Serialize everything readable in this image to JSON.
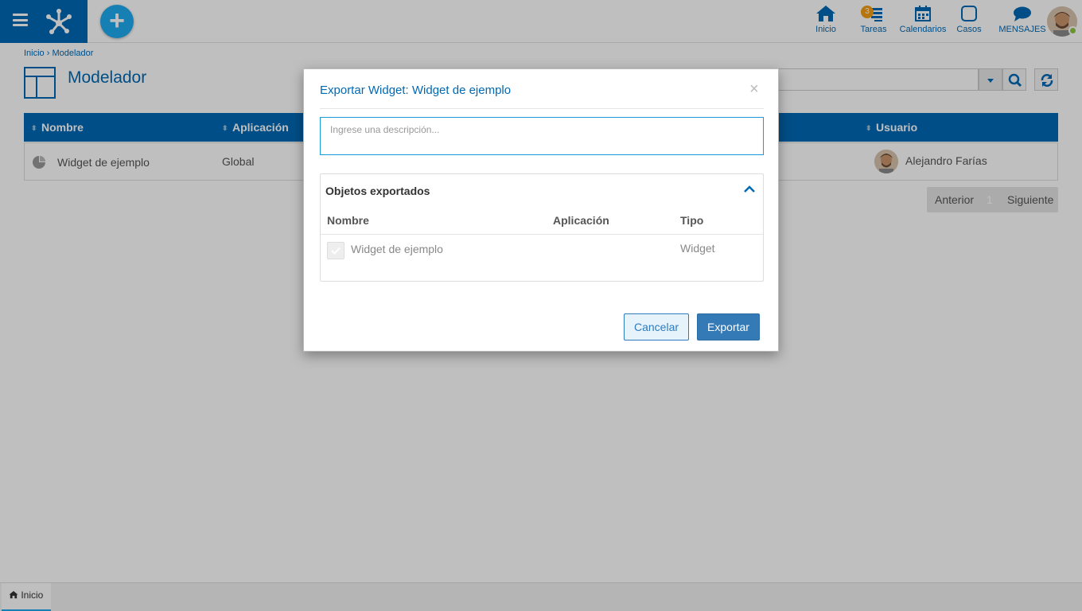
{
  "header": {
    "nav": [
      {
        "label": "Inicio",
        "icon": "home-icon"
      },
      {
        "label": "Tareas",
        "icon": "tasks-icon",
        "badge": "3"
      },
      {
        "label": "Calendarios",
        "icon": "calendar-icon"
      },
      {
        "label": "Casos",
        "icon": "case-icon"
      },
      {
        "label": "MENSAJES",
        "icon": "message-icon"
      }
    ]
  },
  "breadcrumb": "Inicio › Modelador",
  "page": {
    "title": "Modelador"
  },
  "grid": {
    "columns": [
      "Nombre",
      "Aplicación",
      "Usuario"
    ],
    "rows": [
      {
        "nombre": "Widget de ejemplo",
        "aplicacion": "Global",
        "usuario": "Alejandro Farías"
      }
    ]
  },
  "pager": {
    "prev": "Anterior",
    "page": "1",
    "next": "Siguiente"
  },
  "footer": {
    "tab": "Inicio"
  },
  "modal": {
    "title": "Exportar Widget: Widget de ejemplo",
    "description_placeholder": "Ingrese una descripción...",
    "panel_title": "Objetos exportados",
    "columns": [
      "Nombre",
      "Aplicación",
      "Tipo"
    ],
    "rows": [
      {
        "nombre": "Widget de ejemplo",
        "aplicacion": "",
        "tipo": "Widget"
      }
    ],
    "cancel_label": "Cancelar",
    "export_label": "Exportar"
  },
  "colors": {
    "primary": "#0069b4",
    "accent": "#1eaaf1",
    "badge": "#f39c12",
    "online": "#8cc63f"
  }
}
